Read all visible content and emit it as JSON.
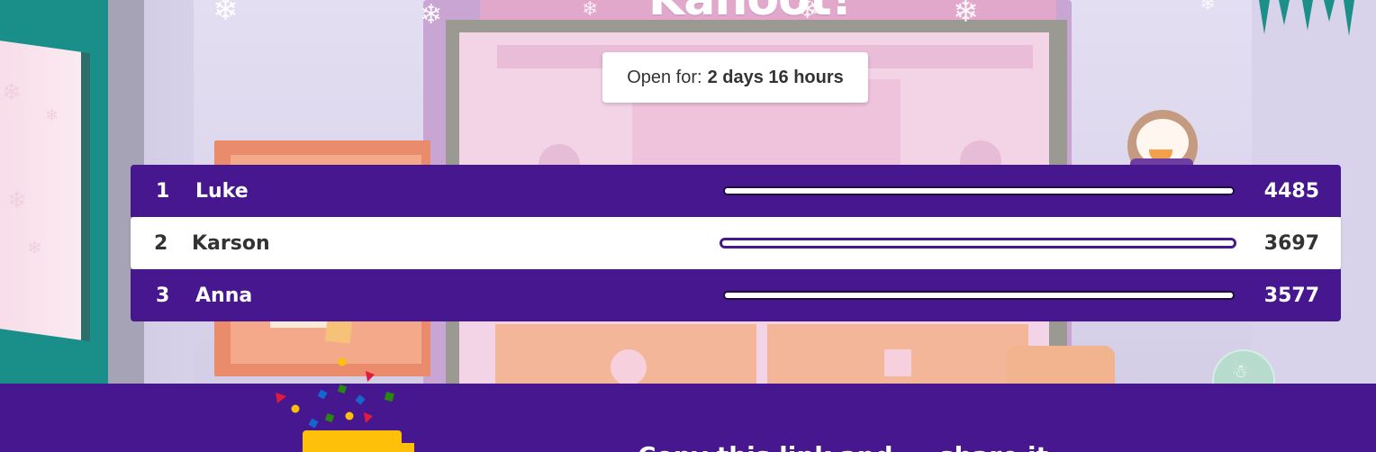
{
  "logo_text": "Kahoot!",
  "timer": {
    "label": "Open for:",
    "value": "2 days 16 hours"
  },
  "leaderboard": {
    "max_score": 4485,
    "rows": [
      {
        "rank": "1",
        "name": "Luke",
        "score": "4485",
        "progress": 1.0,
        "highlighted": false
      },
      {
        "rank": "2",
        "name": "Karson",
        "score": "3697",
        "progress": 1.0,
        "highlighted": true
      },
      {
        "rank": "3",
        "name": "Anna",
        "score": "3577",
        "progress": 1.0,
        "highlighted": false
      }
    ]
  },
  "bottom_band": {
    "text": "Copy this link and ... share it"
  },
  "colors": {
    "kahoot_purple": "#46178f",
    "bar_outline": "#1e0a3c",
    "podium_gold": "#ffc00a",
    "timer_bg": "#ffffff"
  },
  "icons": [
    "snowflake-icon",
    "penguin-illustration",
    "confetti-icon",
    "podium-icon",
    "snow-globe-icon"
  ]
}
